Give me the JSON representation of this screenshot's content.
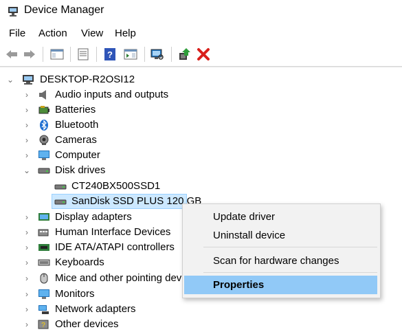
{
  "window": {
    "title": "Device Manager"
  },
  "menu": {
    "items": [
      "File",
      "Action",
      "View",
      "Help"
    ]
  },
  "toolbar": {
    "buttons": [
      "back-icon",
      "forward-icon",
      "show-hide-console-tree-icon",
      "properties-icon",
      "help-icon",
      "action-pane-icon",
      "scan-hardware-icon",
      "update-driver-icon",
      "uninstall-icon"
    ]
  },
  "tree": {
    "root": "DESKTOP-R2OSI12",
    "categories": [
      {
        "label": "Audio inputs and outputs",
        "icon": "speaker-icon",
        "expanded": false
      },
      {
        "label": "Batteries",
        "icon": "battery-icon",
        "expanded": false
      },
      {
        "label": "Bluetooth",
        "icon": "bluetooth-icon",
        "expanded": false
      },
      {
        "label": "Cameras",
        "icon": "camera-icon",
        "expanded": false
      },
      {
        "label": "Computer",
        "icon": "monitor-icon",
        "expanded": false
      },
      {
        "label": "Disk drives",
        "icon": "drive-icon",
        "expanded": true
      },
      {
        "label": "Display adapters",
        "icon": "display-adapter-icon",
        "expanded": false
      },
      {
        "label": "Human Interface Devices",
        "icon": "hid-icon",
        "expanded": false
      },
      {
        "label": "IDE ATA/ATAPI controllers",
        "icon": "ide-controller-icon",
        "expanded": false
      },
      {
        "label": "Keyboards",
        "icon": "keyboard-icon",
        "expanded": false
      },
      {
        "label": "Mice and other pointing dev",
        "icon": "mouse-icon",
        "expanded": false
      },
      {
        "label": "Monitors",
        "icon": "monitor-icon",
        "expanded": false
      },
      {
        "label": "Network adapters",
        "icon": "network-icon",
        "expanded": false
      },
      {
        "label": "Other devices",
        "icon": "unknown-device-icon",
        "expanded": false
      }
    ],
    "disk_drives": [
      {
        "label": "CT240BX500SSD1",
        "selected": false
      },
      {
        "label": "SanDisk SSD PLUS 120 GB",
        "selected": true
      }
    ]
  },
  "context_menu": {
    "items": [
      {
        "label": "Update driver"
      },
      {
        "label": "Uninstall device"
      },
      {
        "label": "Scan for hardware changes"
      },
      {
        "label": "Properties",
        "highlighted": true
      }
    ]
  },
  "colors": {
    "selection": "#cce8ff",
    "selection_border": "#99d1ff",
    "menu_highlight": "#91c9f7",
    "uninstall_red": "#d9201c"
  }
}
